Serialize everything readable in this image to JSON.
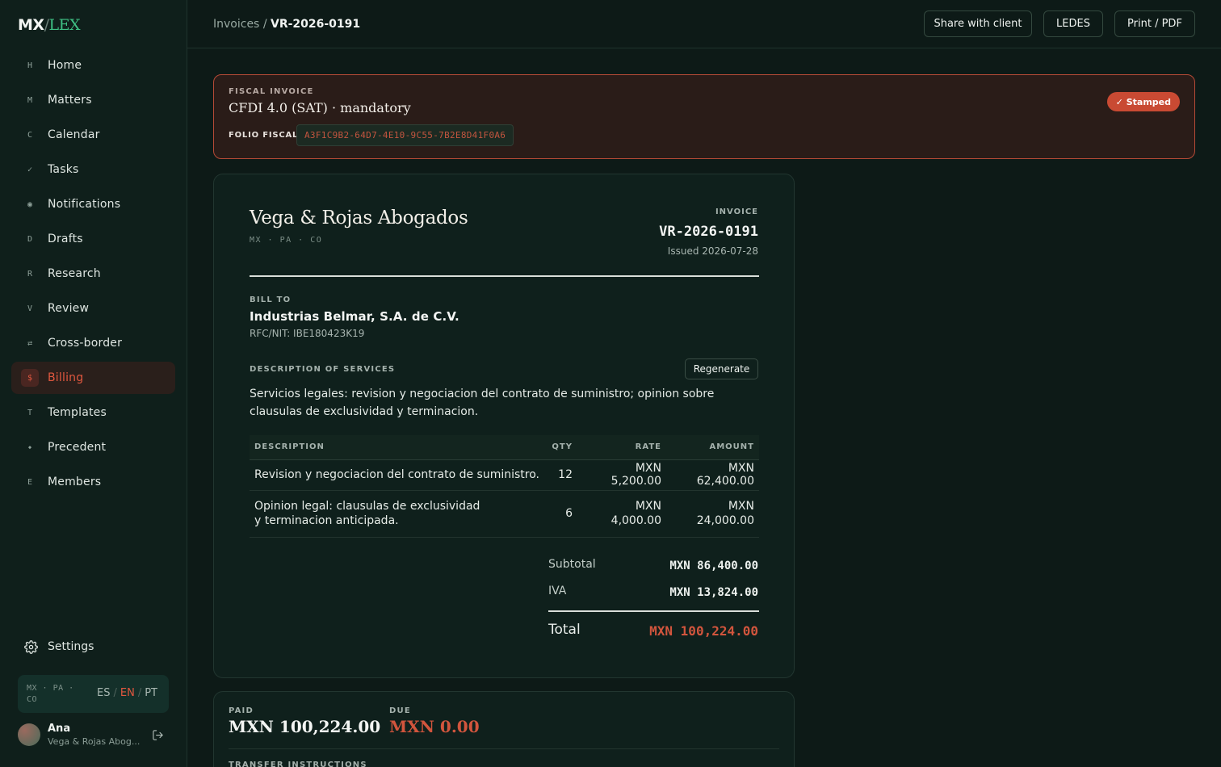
{
  "app": {
    "logo_mx": "MX",
    "logo_slash": "/",
    "logo_lex": "LEX"
  },
  "sidebar": {
    "items": [
      {
        "key": "H",
        "label": "Home"
      },
      {
        "key": "M",
        "label": "Matters"
      },
      {
        "key": "C",
        "label": "Calendar"
      },
      {
        "key": "✓",
        "label": "Tasks"
      },
      {
        "key": "◉",
        "label": "Notifications"
      },
      {
        "key": "D",
        "label": "Drafts"
      },
      {
        "key": "R",
        "label": "Research"
      },
      {
        "key": "V",
        "label": "Review"
      },
      {
        "key": "⇄",
        "label": "Cross-border"
      },
      {
        "key": "$",
        "label": "Billing"
      },
      {
        "key": "T",
        "label": "Templates"
      },
      {
        "key": "◆",
        "label": "Precedent"
      },
      {
        "key": "E",
        "label": "Members"
      }
    ],
    "active_item": "Billing",
    "settings_label": "Settings",
    "jurisdictions": "MX · PA · CO",
    "languages": [
      "ES",
      "EN",
      "PT"
    ],
    "active_language": "EN",
    "user": {
      "name": "Ana",
      "firm": "Vega & Rojas Abog..."
    }
  },
  "topbar": {
    "crumb_parent": "Invoices",
    "crumb_sep": "/",
    "crumb_current": "VR-2026-0191",
    "share_label": "Share with client",
    "ledes_label": "LEDES",
    "print_label": "Print / PDF"
  },
  "fiscal": {
    "eyebrow": "FISCAL INVOICE",
    "title": "CFDI 4.0 (SAT) · mandatory",
    "folio_label": "FOLIO FISCAL",
    "folio_value": "A3F1C9B2-64D7-4E10-9C55-7B2E8D41F0A6",
    "status": "✓ Stamped"
  },
  "invoice": {
    "firm_name": "Vega & Rojas Abogados",
    "firm_jurisdictions": "MX · PA · CO",
    "label": "INVOICE",
    "number": "VR-2026-0191",
    "issued": "Issued 2026-07-28",
    "bill_to_label": "BILL TO",
    "client_name": "Industrias Belmar, S.A. de C.V.",
    "client_rfc": "RFC/NIT: IBE180423K19",
    "description_label": "DESCRIPTION OF SERVICES",
    "regenerate_label": "Regenerate",
    "description_text": "Servicios legales: revision y negociacion del contrato de suministro; opinion sobre clausulas de exclusividad y terminacion.",
    "columns": [
      "DESCRIPTION",
      "QTY",
      "RATE",
      "AMOUNT"
    ],
    "lines": [
      {
        "description": "Revision y negociacion del contrato de suministro.",
        "qty": "12",
        "rate": "MXN 5,200.00",
        "amount": "MXN 62,400.00"
      },
      {
        "description": "Opinion legal: clausulas de exclusividad y terminacion anticipada.",
        "qty": "6",
        "rate": "MXN 4,000.00",
        "amount": "MXN 24,000.00"
      }
    ],
    "subtotal_label": "Subtotal",
    "subtotal_value": "MXN 86,400.00",
    "iva_label": "IVA",
    "iva_value": "MXN 13,824.00",
    "total_label": "Total",
    "total_value": "MXN 100,224.00"
  },
  "payment": {
    "paid_label": "PAID",
    "paid_value": "MXN 100,224.00",
    "due_label": "DUE",
    "due_value": "MXN 0.00",
    "transfer_label": "TRANSFER INSTRUCTIONS"
  },
  "colors": {
    "accent": "#e0573f",
    "brand_green": "#3fc084",
    "background": "#0d1a17"
  }
}
